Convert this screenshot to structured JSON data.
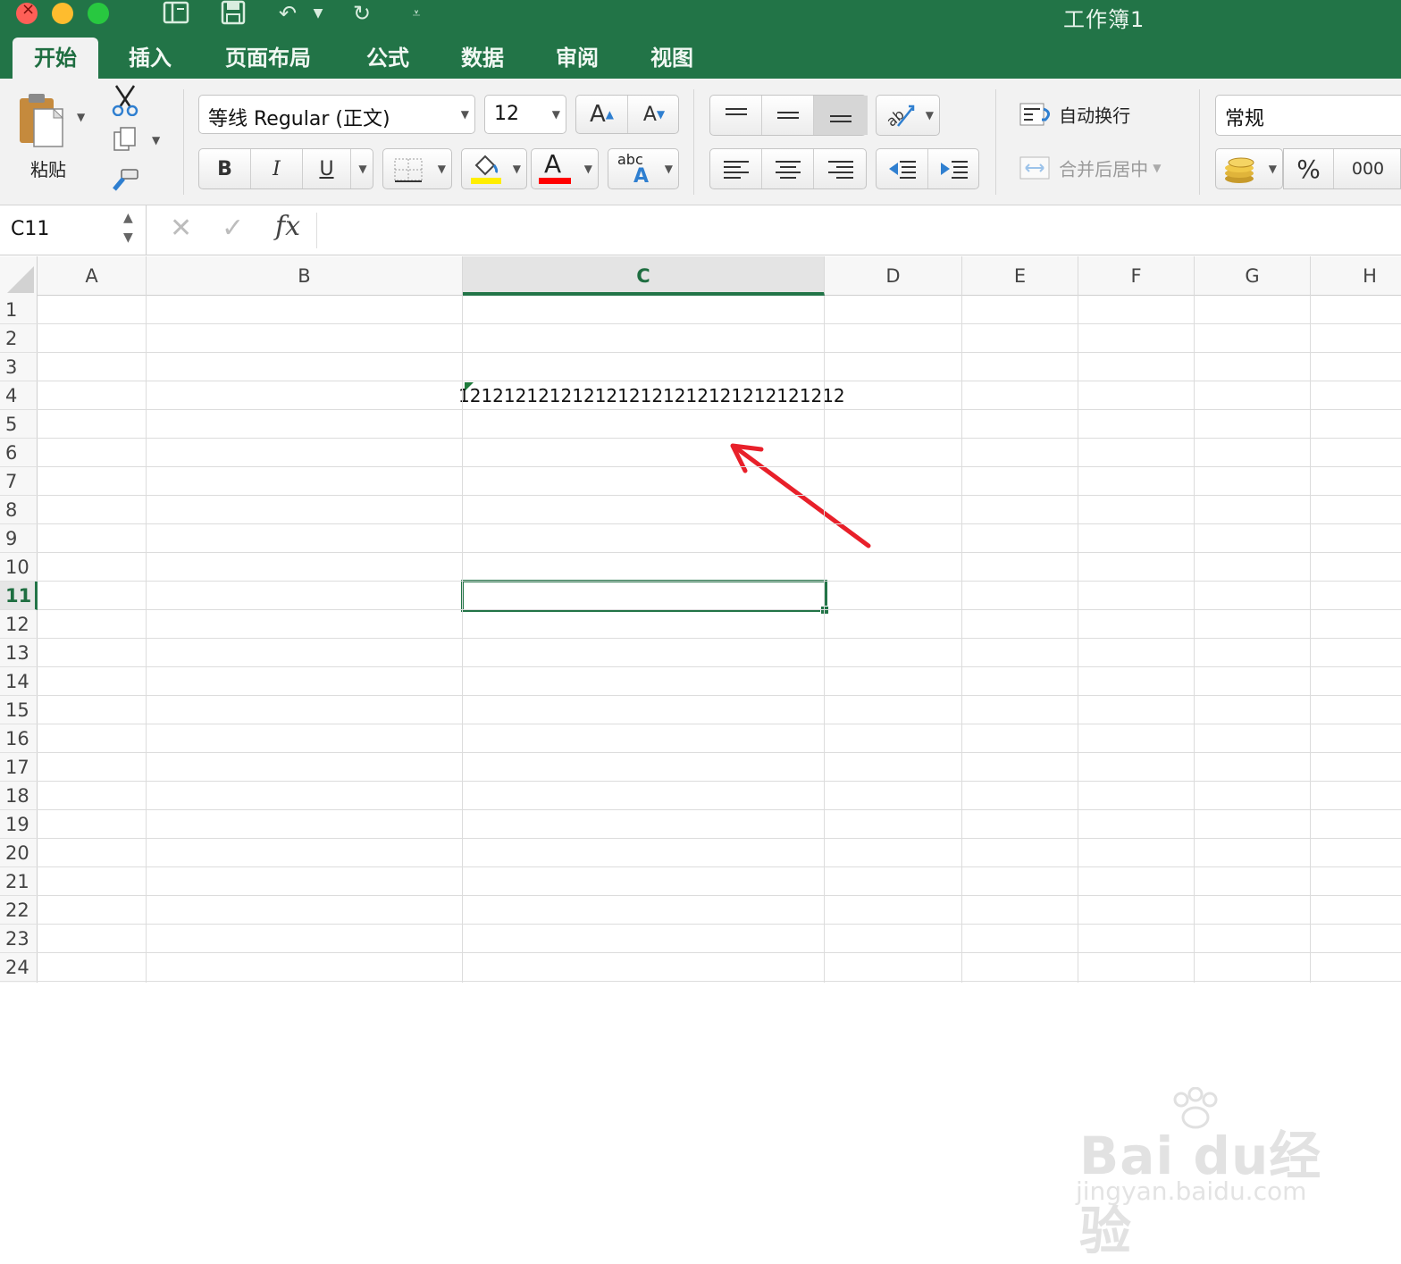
{
  "window": {
    "title": "工作簿1"
  },
  "tabs": [
    {
      "label": "开始",
      "active": true
    },
    {
      "label": "插入",
      "active": false
    },
    {
      "label": "页面布局",
      "active": false
    },
    {
      "label": "公式",
      "active": false
    },
    {
      "label": "数据",
      "active": false
    },
    {
      "label": "审阅",
      "active": false
    },
    {
      "label": "视图",
      "active": false
    }
  ],
  "ribbon": {
    "paste_label": "粘贴",
    "font_name": "等线 Regular (正文)",
    "font_size": "12",
    "bold": "B",
    "italic": "I",
    "underline": "U",
    "increase_font": "A",
    "decrease_font": "A",
    "font_color_glyph": "A",
    "phonetic_top": "abc",
    "phonetic_bottom": "A",
    "wrap_text": "自动换行",
    "merge_center": "合并后居中",
    "number_format": "常规",
    "percent": "%",
    "thousands": "000",
    "colors": {
      "fill": "#ffee00",
      "font": "#ff0000",
      "accent": "#227447"
    }
  },
  "formula_bar": {
    "name_box": "C11",
    "fx": "fx",
    "formula": ""
  },
  "columns": [
    "A",
    "B",
    "C",
    "D",
    "E",
    "F",
    "G",
    "H"
  ],
  "selected_column": "C",
  "rows": [
    "1",
    "2",
    "3",
    "4",
    "5",
    "6",
    "7",
    "8",
    "9",
    "10",
    "11",
    "12",
    "13",
    "14",
    "15",
    "16",
    "17",
    "18",
    "19",
    "20",
    "21",
    "22",
    "23",
    "24"
  ],
  "selected_row": "11",
  "cells": {
    "C4": "1212121212121212121212121212121212"
  },
  "watermark": {
    "brand": "Bai du经验",
    "url": "jingyan.baidu.com"
  }
}
